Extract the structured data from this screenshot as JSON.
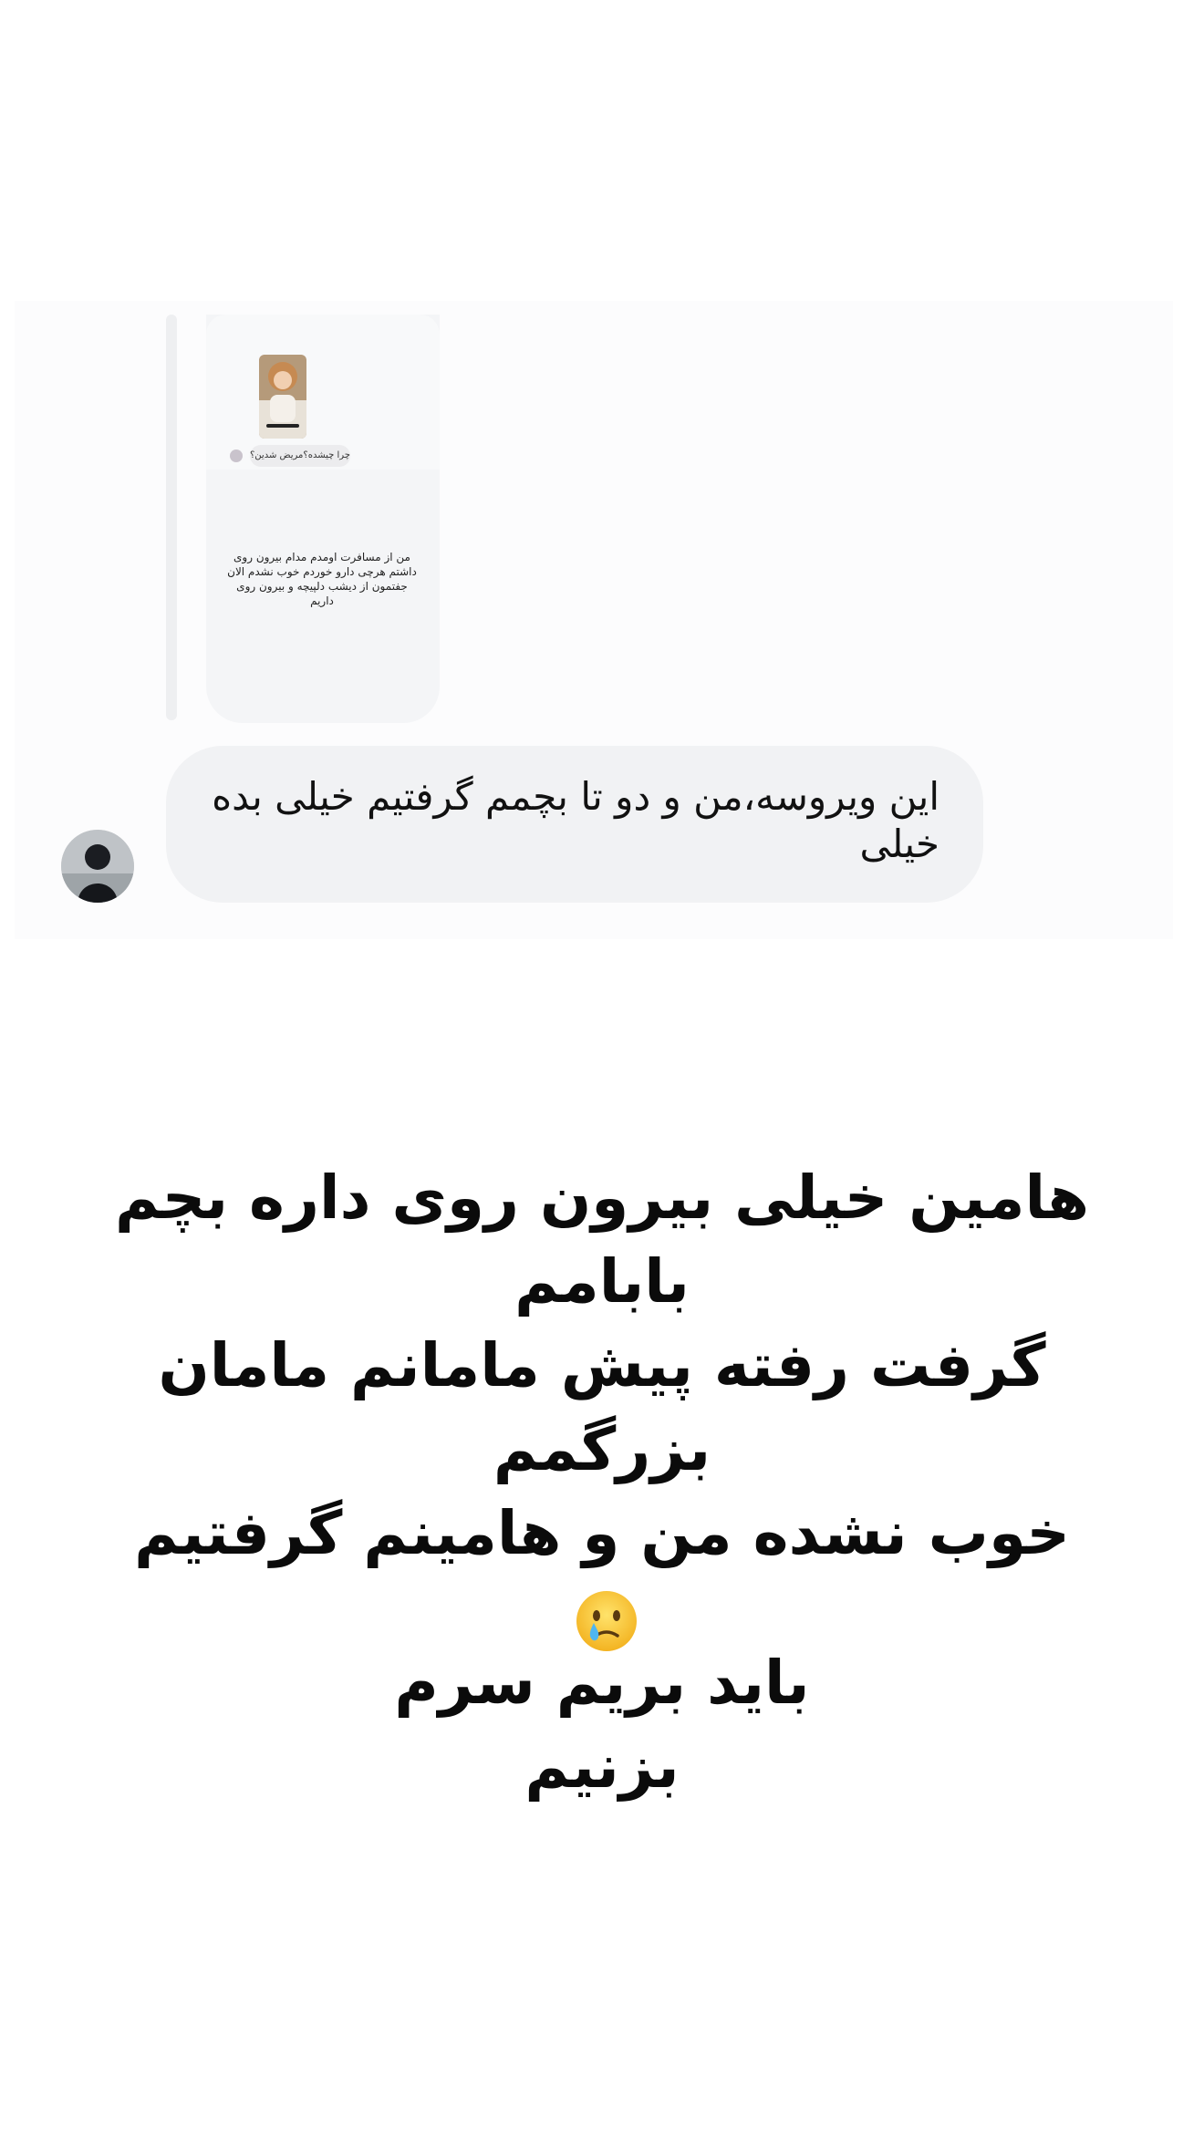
{
  "story_reply": {
    "sticker_question": "چرا چیشده؟مریض شدین؟",
    "answer_lines": [
      "من از مسافرت اومدم مدام بیرون روی",
      "داشتم هرچی دارو خوردم خوب نشدم الان",
      "جفتمون از دیشب دلپیچه و بیرون روی داریم"
    ]
  },
  "message": {
    "text": "این ویروسه،من و دو تا بچمم گرفتیم خیلی بده خیلی"
  },
  "caption": {
    "lines": [
      "هامین خیلی بیرون روی داره بچم بابامم",
      "گرفت رفته پیش مامانم مامان بزرگمم",
      "خوب نشده من و هامینم گرفتیم"
    ],
    "emoji": "crying-face-icon",
    "second": "باید بریم سرم بزنیم"
  },
  "colors": {
    "background": "#ffffff",
    "bubble": "#f1f2f4",
    "text": "#111111"
  }
}
